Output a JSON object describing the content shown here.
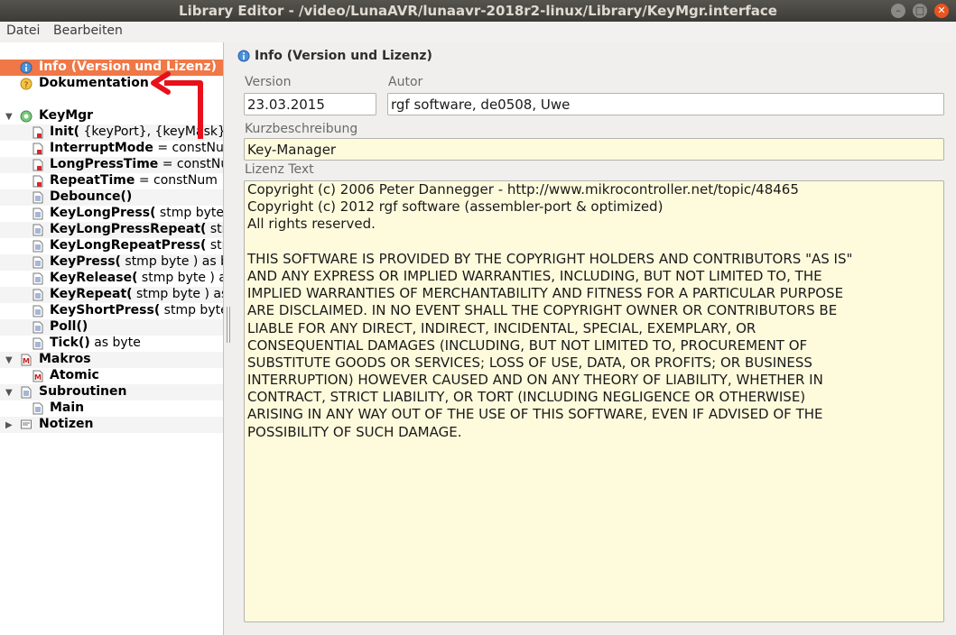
{
  "window": {
    "title": "Library Editor - /video/LunaAVR/lunaavr-2018r2-linux/Library/KeyMgr.interface"
  },
  "menu": {
    "items": [
      "Datei",
      "Bearbeiten"
    ]
  },
  "tree": {
    "items": [
      {
        "bold": "Info (Version und Lizenz)",
        "rest": ""
      },
      {
        "bold": "Dokumentation",
        "rest": ""
      },
      {
        "bold": "KeyMgr",
        "rest": ""
      },
      {
        "bold": "Init(",
        "rest": " {keyPort}, {keyMask}, ..."
      },
      {
        "bold": "InterruptMode",
        "rest": " = constNum"
      },
      {
        "bold": "LongPressTime",
        "rest": " = constNum"
      },
      {
        "bold": "RepeatTime",
        "rest": " = constNum"
      },
      {
        "bold": "Debounce()",
        "rest": ""
      },
      {
        "bold": "KeyLongPress(",
        "rest": " stmp byte"
      },
      {
        "bold": "KeyLongPressRepeat(",
        "rest": " stmp"
      },
      {
        "bold": "KeyLongRepeatPress(",
        "rest": " stm"
      },
      {
        "bold": "KeyPress(",
        "rest": " stmp byte ) as b"
      },
      {
        "bold": "KeyRelease(",
        "rest": " stmp byte ) a"
      },
      {
        "bold": "KeyRepeat(",
        "rest": " stmp byte ) as"
      },
      {
        "bold": "KeyShortPress(",
        "rest": " stmp byte"
      },
      {
        "bold": "Poll()",
        "rest": ""
      },
      {
        "bold": "Tick()",
        "rest": " as byte"
      },
      {
        "bold": "Makros",
        "rest": ""
      },
      {
        "bold": "Atomic",
        "rest": ""
      },
      {
        "bold": "Subroutinen",
        "rest": ""
      },
      {
        "bold": "Main",
        "rest": ""
      },
      {
        "bold": "Notizen",
        "rest": ""
      }
    ]
  },
  "panel": {
    "header": "Info (Version und Lizenz)",
    "version_label": "Version",
    "version_value": "23.03.2015",
    "author_label": "Autor",
    "author_value": "rgf software, de0508, Uwe",
    "short_label": "Kurzbeschreibung",
    "short_value": "Key-Manager",
    "license_label": "Lizenz Text",
    "license_lines": [
      "Copyright (c) 2006 Peter Dannegger - http://www.mikrocontroller.net/topic/48465",
      "Copyright (c) 2012 rgf software (assembler-port & optimized)",
      "All rights reserved.",
      "",
      "THIS SOFTWARE IS PROVIDED BY THE COPYRIGHT HOLDERS AND CONTRIBUTORS \"AS IS\"",
      "AND ANY EXPRESS OR IMPLIED WARRANTIES, INCLUDING, BUT NOT LIMITED TO, THE",
      "IMPLIED WARRANTIES OF MERCHANTABILITY AND FITNESS FOR A PARTICULAR PURPOSE",
      "ARE DISCLAIMED. IN NO EVENT SHALL THE COPYRIGHT OWNER OR CONTRIBUTORS BE",
      "LIABLE FOR ANY DIRECT, INDIRECT, INCIDENTAL, SPECIAL, EXEMPLARY, OR",
      "CONSEQUENTIAL DAMAGES (INCLUDING, BUT NOT LIMITED TO, PROCUREMENT OF",
      "SUBSTITUTE GOODS OR SERVICES; LOSS OF USE, DATA, OR PROFITS; OR BUSINESS",
      "INTERRUPTION) HOWEVER CAUSED AND ON ANY THEORY OF LIABILITY, WHETHER IN",
      "CONTRACT, STRICT LIABILITY, OR TORT (INCLUDING NEGLIGENCE OR OTHERWISE)",
      "ARISING IN ANY WAY OUT OF THE USE OF THIS SOFTWARE, EVEN IF ADVISED OF THE",
      "POSSIBILITY OF SUCH DAMAGE."
    ]
  },
  "colors": {
    "selection": "#f07746",
    "field_yellow": "#fefbdd",
    "annotation_arrow": "#e8101a"
  }
}
